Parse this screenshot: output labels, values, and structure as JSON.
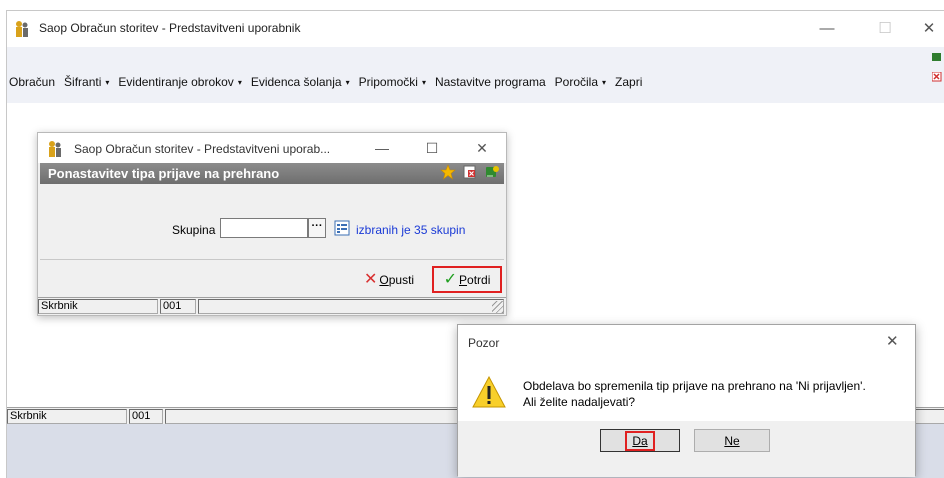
{
  "main_window": {
    "title": "Saop Obračun storitev - Predstavitveni uporabnik",
    "controls": {
      "minimize": "—",
      "maximize": "☐",
      "close": "✕"
    },
    "menu": [
      {
        "label": "Obračun",
        "has_arrow": false
      },
      {
        "label": "Šifranti",
        "has_arrow": true
      },
      {
        "label": "Evidentiranje obrokov",
        "has_arrow": true
      },
      {
        "label": "Evidenca šolanja",
        "has_arrow": true
      },
      {
        "label": "Pripomočki",
        "has_arrow": true
      },
      {
        "label": "Nastavitve programa",
        "has_arrow": false
      },
      {
        "label": "Poročila",
        "has_arrow": true
      },
      {
        "label": "Zapri",
        "has_arrow": false
      }
    ],
    "menu_arrow": "▾",
    "status": {
      "user": "Skrbnik",
      "code": "001"
    }
  },
  "inner_dialog": {
    "title": "Saop Obračun storitev - Predstavitveni uporab...",
    "controls": {
      "minimize": "—",
      "maximize": "☐",
      "close": "✕"
    },
    "header": "Ponastavitev tipa prijave na prehrano",
    "skupina_label": "Skupina",
    "skupina_value": "",
    "dots": "···",
    "selected_info": "izbranih je 35 skupin",
    "cancel_label": "Opusti",
    "confirm_label": "Potrdi",
    "status": {
      "user": "Skrbnik",
      "code": "001"
    }
  },
  "alert": {
    "title": "Pozor",
    "close": "✕",
    "message_line1": "Obdelava bo spremenila tip prijave na prehrano na 'Ni prijavljen'.",
    "message_line2": "Ali želite nadaljevati?",
    "yes_label": "Da",
    "no_label": "Ne"
  },
  "colors": {
    "highlight": "#e02020",
    "link": "#1a3ad6",
    "header_bg": "#7d7d7d"
  }
}
